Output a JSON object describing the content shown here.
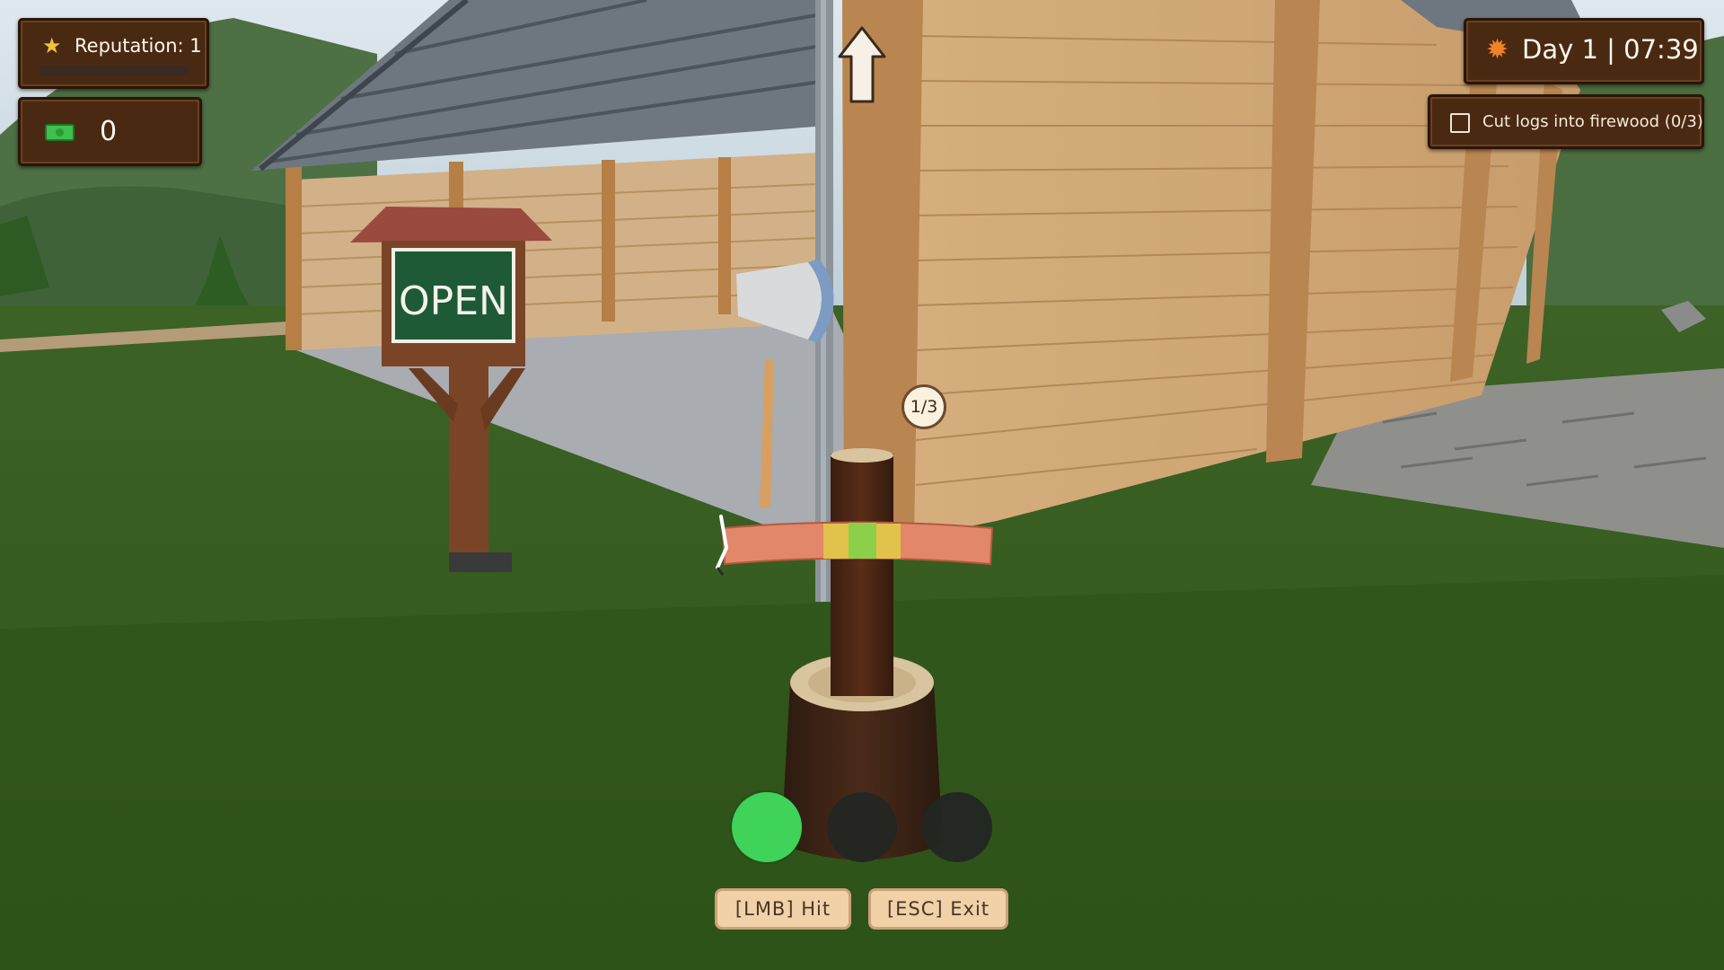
{
  "hud": {
    "reputation": {
      "label": "Reputation: 1",
      "progress": 0.0,
      "icon": "star-icon"
    },
    "money": {
      "value": "0",
      "icon": "cash-icon"
    },
    "clock": {
      "day": "Day 1",
      "separator": "|",
      "time": "07:39",
      "icon": "sun-icon"
    },
    "quest": {
      "text": "Cut logs into firewood (0/3)",
      "checked": false
    }
  },
  "scene": {
    "sign_text": "OPEN"
  },
  "minigame": {
    "counter": "1/3",
    "strikes": {
      "completed": 1,
      "total": 3
    },
    "colors": {
      "success": "#3fd35a",
      "pending": "#232623",
      "zone_good": "#e1c24a",
      "zone_perfect": "#8cd04a",
      "bar": "#e2876a"
    }
  },
  "controls": {
    "hit": "[LMB] Hit",
    "exit": "[ESC] Exit"
  }
}
